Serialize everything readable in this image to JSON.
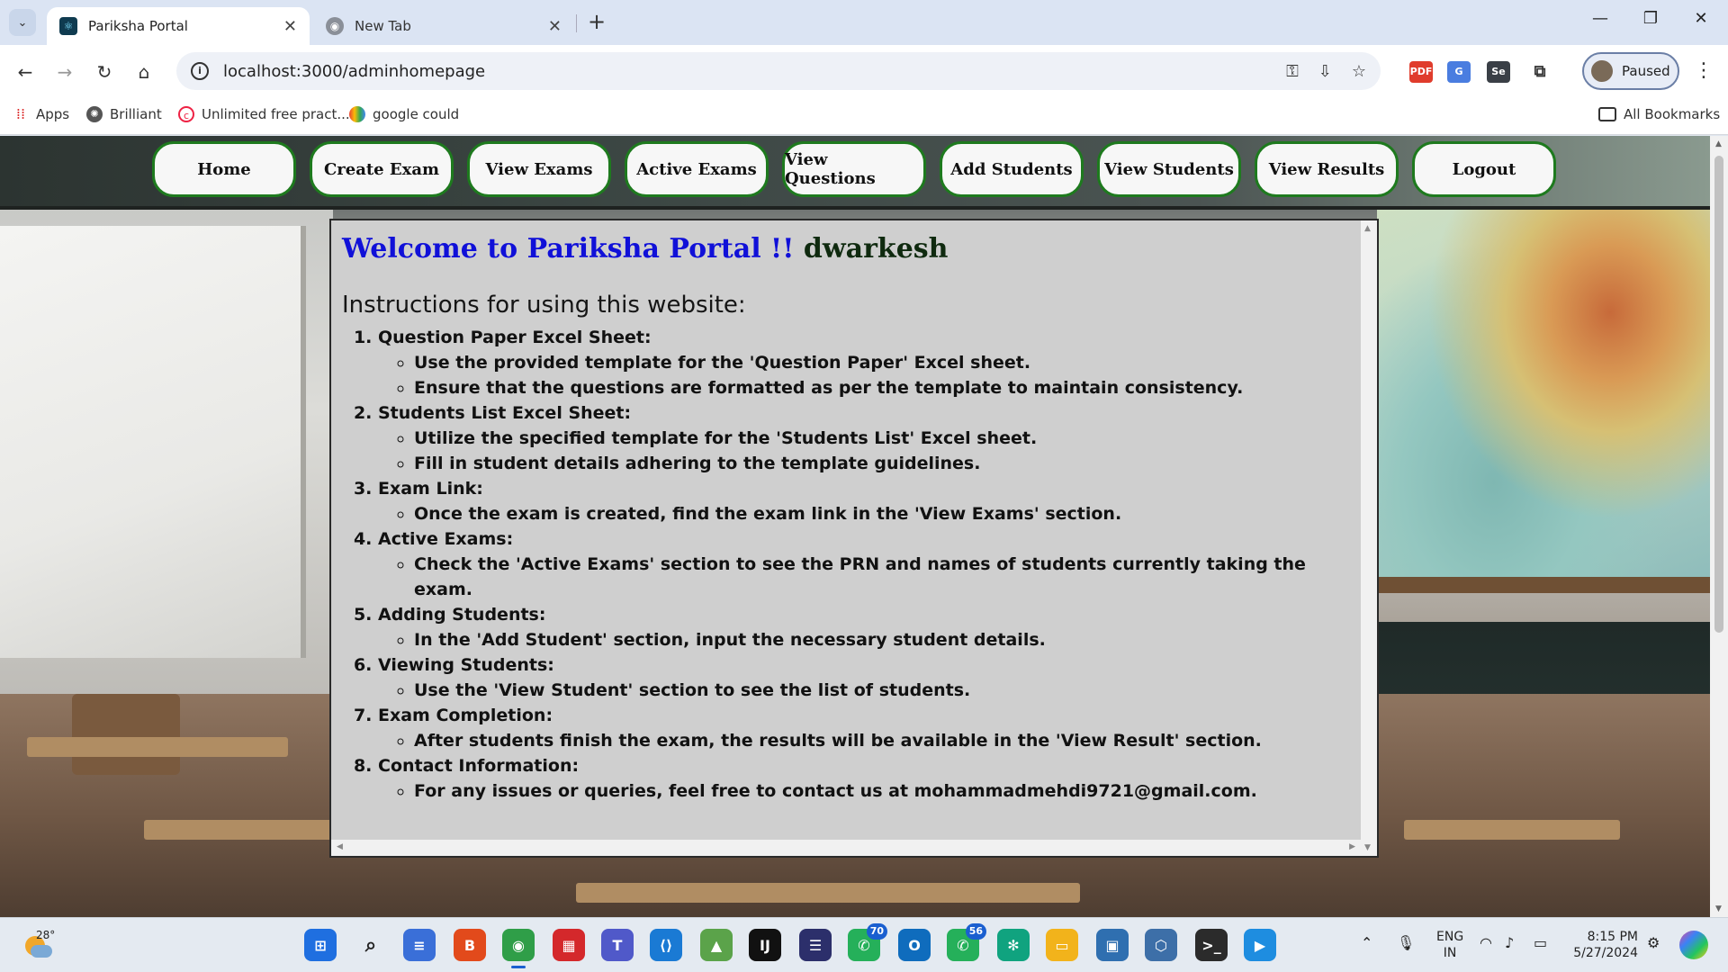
{
  "browser": {
    "tabs": [
      {
        "title": "Pariksha Portal",
        "active": true
      },
      {
        "title": "New Tab",
        "active": false
      }
    ],
    "url": "localhost:3000/adminhomepage",
    "profile_label": "Paused",
    "bookmarks": [
      {
        "label": "Apps",
        "icon": "apps-grid-icon"
      },
      {
        "label": "Brilliant",
        "icon": "brilliant-icon"
      },
      {
        "label": "Unlimited free pract...",
        "icon": "link-icon"
      },
      {
        "label": "google could",
        "icon": "google-cloud-icon"
      }
    ],
    "all_bookmarks_label": "All Bookmarks"
  },
  "nav": {
    "items": [
      "Home",
      "Create Exam",
      "View Exams",
      "Active Exams",
      "View Questions",
      "Add Students",
      "View Students",
      "View Results",
      "Logout"
    ],
    "border_color": "#1e7a1e"
  },
  "content": {
    "welcome_text": "Welcome to Pariksha Portal !!",
    "username": "dwarkesh",
    "instructions_title": "Instructions for using this website:",
    "steps": [
      {
        "title": "Question Paper Excel Sheet:",
        "points": [
          "Use the provided template for the 'Question Paper' Excel sheet.",
          "Ensure that the questions are formatted as per the template to maintain consistency."
        ]
      },
      {
        "title": "Students List Excel Sheet:",
        "points": [
          "Utilize the specified template for the 'Students List' Excel sheet.",
          "Fill in student details adhering to the template guidelines."
        ]
      },
      {
        "title": "Exam Link:",
        "points": [
          "Once the exam is created, find the exam link in the 'View Exams' section."
        ]
      },
      {
        "title": "Active Exams:",
        "points": [
          "Check the 'Active Exams' section to see the PRN and names of students currently taking the exam."
        ]
      },
      {
        "title": "Adding Students:",
        "points": [
          "In the 'Add Student' section, input the necessary student details."
        ]
      },
      {
        "title": "Viewing Students:",
        "points": [
          "Use the 'View Student' section to see the list of students."
        ]
      },
      {
        "title": "Exam Completion:",
        "points": [
          "After students finish the exam, the results will be available in the 'View Result' section."
        ]
      },
      {
        "title": "Contact Information:",
        "points": [
          "For any issues or queries, feel free to contact us at mohammadmehdi9721@gmail.com."
        ]
      }
    ],
    "welcome_color": "#1010d8",
    "username_color": "#0f2a0f"
  },
  "taskbar": {
    "weather_temp": "28°",
    "whatsapp_badge": "70",
    "whatsapp2_badge": "56",
    "language": "ENG",
    "region": "IN",
    "time": "8:15 PM",
    "date": "5/27/2024"
  }
}
